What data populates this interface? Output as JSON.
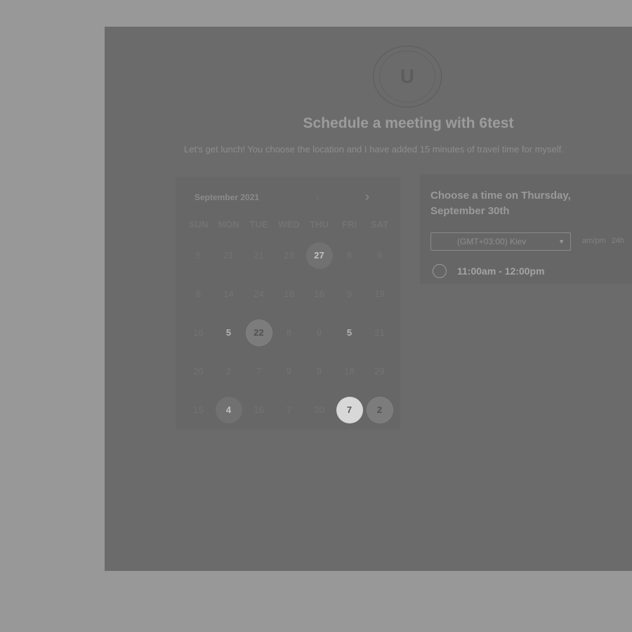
{
  "header": {
    "avatar_letter": "U",
    "title": "Schedule a meeting with 6test",
    "subtitle": "Let's get lunch! You choose the location and I have added 15 minutes of travel time for myself."
  },
  "calendar": {
    "month": "September 2021",
    "prev_icon": "chevron-left-icon",
    "next_icon": "chevron-right-icon",
    "weekdays": [
      "SUN",
      "MON",
      "TUE",
      "WED",
      "THU",
      "FRI",
      "SAT"
    ],
    "weeks": [
      [
        "5",
        "21",
        "21",
        "23",
        "27",
        "8",
        "9"
      ],
      [
        "8",
        "14",
        "24",
        "16",
        "16",
        "9",
        "19"
      ],
      [
        "16",
        "5",
        "22",
        "8",
        "9",
        "5",
        "21"
      ],
      [
        "26",
        "2",
        "7",
        "9",
        "9",
        "18",
        "29"
      ],
      [
        "15",
        "4",
        "16",
        "7",
        "20",
        "7",
        "2"
      ]
    ]
  },
  "times": {
    "heading": "Choose a time on Thursday, September 30th",
    "timezone": "(GMT+03:00) Kiev",
    "format_ampm": "am/pm",
    "format_24h": "24h",
    "slots": [
      {
        "label": "11:00am - 12:00pm"
      }
    ]
  }
}
